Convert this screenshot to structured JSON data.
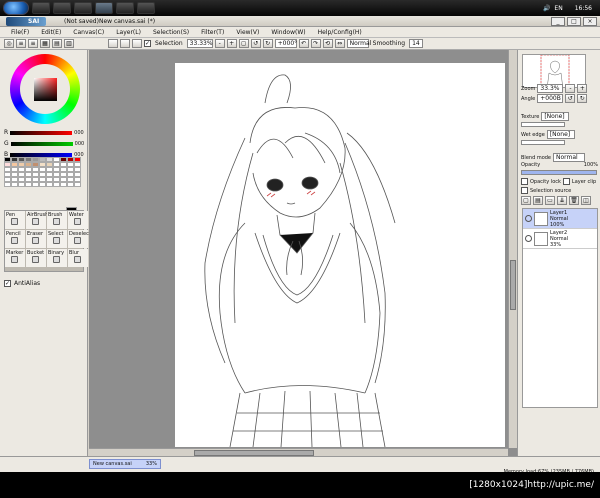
{
  "taskbar": {
    "clock": "16:56",
    "lang": "EN"
  },
  "window": {
    "app_name": "SAI",
    "title": "(Not saved)New canvas.sai (*)"
  },
  "menu": [
    "File(F)",
    "Edit(E)",
    "Canvas(C)",
    "Layer(L)",
    "Selection(S)",
    "Filter(T)",
    "View(V)",
    "Window(W)",
    "Help/Config(H)"
  ],
  "toolbar": {
    "selection_label": "Selection",
    "zoom": "33.33%",
    "angle": "+000°",
    "blend": "Normal",
    "smoothing_label": "Smoothing",
    "smoothing": "14"
  },
  "color": {
    "r_label": "R",
    "g_label": "G",
    "b_label": "B",
    "r": "000",
    "g": "000",
    "b": "000"
  },
  "tools": [
    {
      "label": "Pen"
    },
    {
      "label": "AirBrush"
    },
    {
      "label": "Brush"
    },
    {
      "label": "Water"
    },
    {
      "label": "Pencil"
    },
    {
      "label": "Eraser"
    },
    {
      "label": "Select"
    },
    {
      "label": "Deselect"
    },
    {
      "label": "Marker"
    },
    {
      "label": "Bucket"
    },
    {
      "label": "Binary"
    },
    {
      "label": "Blur"
    }
  ],
  "antialias_label": "AntiAlias",
  "navigator": {
    "zoom_label": "Zoom",
    "zoom": "33.3%",
    "angle_label": "Angle",
    "angle": "+000B"
  },
  "texture": {
    "label": "Texture",
    "value": "[None]"
  },
  "wet_edge": {
    "label": "Wet edge",
    "value": "[None]"
  },
  "blend_mode": {
    "label": "Blend mode",
    "value": "Normal"
  },
  "opacity": {
    "label": "Opacity",
    "value": "100%"
  },
  "checks": {
    "opacity_lock": "Opacity lock",
    "layer_clip": "Layer clip",
    "selection_source": "Selection source"
  },
  "layers": [
    {
      "name": "Layer1",
      "mode": "Normal",
      "opacity": "100%"
    },
    {
      "name": "Layer2",
      "mode": "Normal",
      "opacity": "33%"
    }
  ],
  "status": {
    "doc_name": "New canvas.sai",
    "doc_zoom": "33%",
    "memory": "Memory load:67% (235MB / 776MB)"
  },
  "watermark": "[1280x1024]http://upic.me/"
}
